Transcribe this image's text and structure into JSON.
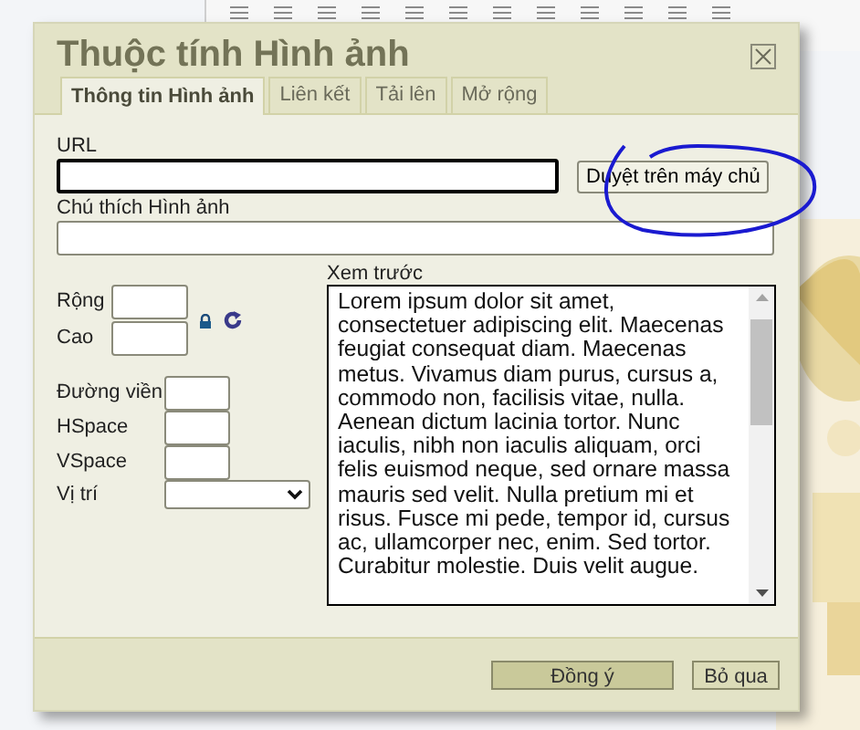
{
  "dialog": {
    "title": "Thuộc tính Hình ảnh",
    "tabs": [
      {
        "label": "Thông tin Hình ảnh",
        "selected": true
      },
      {
        "label": "Liên kết",
        "selected": false
      },
      {
        "label": "Tải lên",
        "selected": false
      },
      {
        "label": "Mở rộng",
        "selected": false
      }
    ],
    "url": {
      "label": "URL",
      "focused": true
    },
    "browse_button": "Duyệt trên máy chủ",
    "caption": {
      "label": "Chú thích Hình ảnh"
    },
    "size_fields": [
      {
        "label": "Rộng"
      },
      {
        "label": "Cao"
      }
    ],
    "spacing_fields": [
      {
        "label": "Đường viền"
      },
      {
        "label": "HSpace"
      },
      {
        "label": "VSpace"
      }
    ],
    "align": {
      "label": "Vị trí"
    },
    "preview": {
      "label": "Xem trước",
      "text": "Lorem ipsum dolor sit amet, consectetuer adipiscing elit. Maecenas feugiat consequat diam. Maecenas metus. Vivamus diam purus, cursus a, commodo non, facilisis vitae, nulla. Aenean dictum lacinia tortor. Nunc iaculis, nibh non iaculis aliquam, orci felis euismod neque, sed ornare massa mauris sed velit. Nulla pretium mi et risus. Fusce mi pede, tempor id, cursus ac, ullamcorper nec, enim. Sed tortor. Curabitur molestie. Duis velit augue."
    },
    "buttons": [
      {
        "label": "Đồng ý",
        "kind": "primary"
      },
      {
        "label": "Bỏ qua",
        "kind": "secondary"
      }
    ]
  }
}
